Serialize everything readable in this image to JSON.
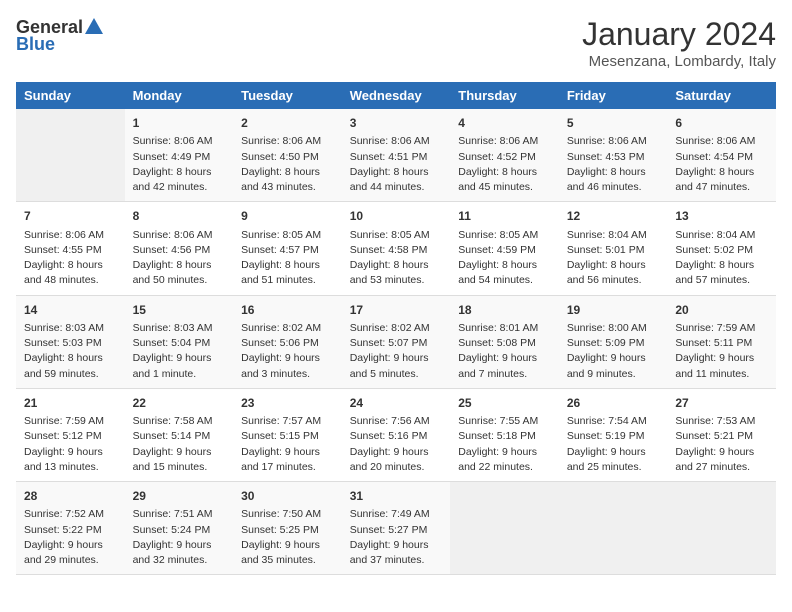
{
  "header": {
    "logo_line1": "General",
    "logo_line2": "Blue",
    "title": "January 2024",
    "subtitle": "Mesenzana, Lombardy, Italy"
  },
  "weekdays": [
    "Sunday",
    "Monday",
    "Tuesday",
    "Wednesday",
    "Thursday",
    "Friday",
    "Saturday"
  ],
  "weeks": [
    [
      {
        "day": "",
        "empty": true
      },
      {
        "day": "1",
        "sunrise": "Sunrise: 8:06 AM",
        "sunset": "Sunset: 4:49 PM",
        "daylight": "Daylight: 8 hours and 42 minutes."
      },
      {
        "day": "2",
        "sunrise": "Sunrise: 8:06 AM",
        "sunset": "Sunset: 4:50 PM",
        "daylight": "Daylight: 8 hours and 43 minutes."
      },
      {
        "day": "3",
        "sunrise": "Sunrise: 8:06 AM",
        "sunset": "Sunset: 4:51 PM",
        "daylight": "Daylight: 8 hours and 44 minutes."
      },
      {
        "day": "4",
        "sunrise": "Sunrise: 8:06 AM",
        "sunset": "Sunset: 4:52 PM",
        "daylight": "Daylight: 8 hours and 45 minutes."
      },
      {
        "day": "5",
        "sunrise": "Sunrise: 8:06 AM",
        "sunset": "Sunset: 4:53 PM",
        "daylight": "Daylight: 8 hours and 46 minutes."
      },
      {
        "day": "6",
        "sunrise": "Sunrise: 8:06 AM",
        "sunset": "Sunset: 4:54 PM",
        "daylight": "Daylight: 8 hours and 47 minutes."
      }
    ],
    [
      {
        "day": "7",
        "sunrise": "Sunrise: 8:06 AM",
        "sunset": "Sunset: 4:55 PM",
        "daylight": "Daylight: 8 hours and 48 minutes."
      },
      {
        "day": "8",
        "sunrise": "Sunrise: 8:06 AM",
        "sunset": "Sunset: 4:56 PM",
        "daylight": "Daylight: 8 hours and 50 minutes."
      },
      {
        "day": "9",
        "sunrise": "Sunrise: 8:05 AM",
        "sunset": "Sunset: 4:57 PM",
        "daylight": "Daylight: 8 hours and 51 minutes."
      },
      {
        "day": "10",
        "sunrise": "Sunrise: 8:05 AM",
        "sunset": "Sunset: 4:58 PM",
        "daylight": "Daylight: 8 hours and 53 minutes."
      },
      {
        "day": "11",
        "sunrise": "Sunrise: 8:05 AM",
        "sunset": "Sunset: 4:59 PM",
        "daylight": "Daylight: 8 hours and 54 minutes."
      },
      {
        "day": "12",
        "sunrise": "Sunrise: 8:04 AM",
        "sunset": "Sunset: 5:01 PM",
        "daylight": "Daylight: 8 hours and 56 minutes."
      },
      {
        "day": "13",
        "sunrise": "Sunrise: 8:04 AM",
        "sunset": "Sunset: 5:02 PM",
        "daylight": "Daylight: 8 hours and 57 minutes."
      }
    ],
    [
      {
        "day": "14",
        "sunrise": "Sunrise: 8:03 AM",
        "sunset": "Sunset: 5:03 PM",
        "daylight": "Daylight: 8 hours and 59 minutes."
      },
      {
        "day": "15",
        "sunrise": "Sunrise: 8:03 AM",
        "sunset": "Sunset: 5:04 PM",
        "daylight": "Daylight: 9 hours and 1 minute."
      },
      {
        "day": "16",
        "sunrise": "Sunrise: 8:02 AM",
        "sunset": "Sunset: 5:06 PM",
        "daylight": "Daylight: 9 hours and 3 minutes."
      },
      {
        "day": "17",
        "sunrise": "Sunrise: 8:02 AM",
        "sunset": "Sunset: 5:07 PM",
        "daylight": "Daylight: 9 hours and 5 minutes."
      },
      {
        "day": "18",
        "sunrise": "Sunrise: 8:01 AM",
        "sunset": "Sunset: 5:08 PM",
        "daylight": "Daylight: 9 hours and 7 minutes."
      },
      {
        "day": "19",
        "sunrise": "Sunrise: 8:00 AM",
        "sunset": "Sunset: 5:09 PM",
        "daylight": "Daylight: 9 hours and 9 minutes."
      },
      {
        "day": "20",
        "sunrise": "Sunrise: 7:59 AM",
        "sunset": "Sunset: 5:11 PM",
        "daylight": "Daylight: 9 hours and 11 minutes."
      }
    ],
    [
      {
        "day": "21",
        "sunrise": "Sunrise: 7:59 AM",
        "sunset": "Sunset: 5:12 PM",
        "daylight": "Daylight: 9 hours and 13 minutes."
      },
      {
        "day": "22",
        "sunrise": "Sunrise: 7:58 AM",
        "sunset": "Sunset: 5:14 PM",
        "daylight": "Daylight: 9 hours and 15 minutes."
      },
      {
        "day": "23",
        "sunrise": "Sunrise: 7:57 AM",
        "sunset": "Sunset: 5:15 PM",
        "daylight": "Daylight: 9 hours and 17 minutes."
      },
      {
        "day": "24",
        "sunrise": "Sunrise: 7:56 AM",
        "sunset": "Sunset: 5:16 PM",
        "daylight": "Daylight: 9 hours and 20 minutes."
      },
      {
        "day": "25",
        "sunrise": "Sunrise: 7:55 AM",
        "sunset": "Sunset: 5:18 PM",
        "daylight": "Daylight: 9 hours and 22 minutes."
      },
      {
        "day": "26",
        "sunrise": "Sunrise: 7:54 AM",
        "sunset": "Sunset: 5:19 PM",
        "daylight": "Daylight: 9 hours and 25 minutes."
      },
      {
        "day": "27",
        "sunrise": "Sunrise: 7:53 AM",
        "sunset": "Sunset: 5:21 PM",
        "daylight": "Daylight: 9 hours and 27 minutes."
      }
    ],
    [
      {
        "day": "28",
        "sunrise": "Sunrise: 7:52 AM",
        "sunset": "Sunset: 5:22 PM",
        "daylight": "Daylight: 9 hours and 29 minutes."
      },
      {
        "day": "29",
        "sunrise": "Sunrise: 7:51 AM",
        "sunset": "Sunset: 5:24 PM",
        "daylight": "Daylight: 9 hours and 32 minutes."
      },
      {
        "day": "30",
        "sunrise": "Sunrise: 7:50 AM",
        "sunset": "Sunset: 5:25 PM",
        "daylight": "Daylight: 9 hours and 35 minutes."
      },
      {
        "day": "31",
        "sunrise": "Sunrise: 7:49 AM",
        "sunset": "Sunset: 5:27 PM",
        "daylight": "Daylight: 9 hours and 37 minutes."
      },
      {
        "day": "",
        "empty": true
      },
      {
        "day": "",
        "empty": true
      },
      {
        "day": "",
        "empty": true
      }
    ]
  ]
}
